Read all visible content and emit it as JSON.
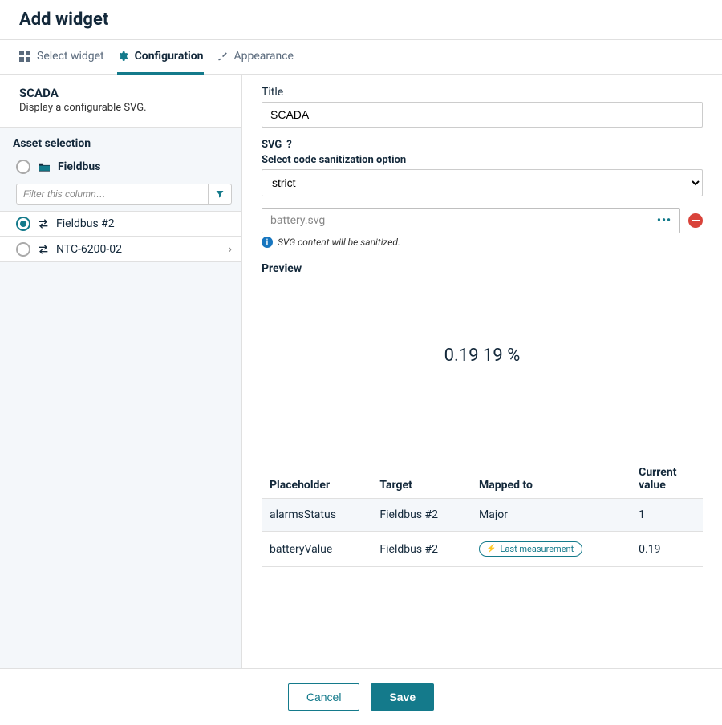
{
  "page_title": "Add widget",
  "tabs": {
    "select_widget": "Select widget",
    "configuration": "Configuration",
    "appearance": "Appearance"
  },
  "widget": {
    "name": "SCADA",
    "description": "Display a configurable SVG."
  },
  "asset_selection": {
    "header": "Asset selection",
    "filter_placeholder": "Filter this column…",
    "tree": {
      "root": "Fieldbus",
      "node_a": "Fieldbus #2",
      "node_b": "NTC-6200-02"
    }
  },
  "form": {
    "title_label": "Title",
    "title_value": "SCADA",
    "svg_label": "SVG",
    "sanitize_label": "Select code sanitization option",
    "sanitize_value": "strict",
    "file_value": "battery.svg",
    "sanitize_note": "SVG content will be sanitized.",
    "preview_label": "Preview",
    "preview_value": "0.19 19 %"
  },
  "mapping": {
    "headers": {
      "placeholder": "Placeholder",
      "target": "Target",
      "mapped": "Mapped to",
      "current": "Current value"
    },
    "rows": [
      {
        "placeholder": "alarmsStatus",
        "target": "Fieldbus #2",
        "mapped": "Major",
        "current": "1"
      },
      {
        "placeholder": "batteryValue",
        "target": "Fieldbus #2",
        "mapped": "Last measurement",
        "current": "0.19"
      }
    ],
    "badge_label": "Last measurement"
  },
  "buttons": {
    "cancel": "Cancel",
    "save": "Save"
  }
}
